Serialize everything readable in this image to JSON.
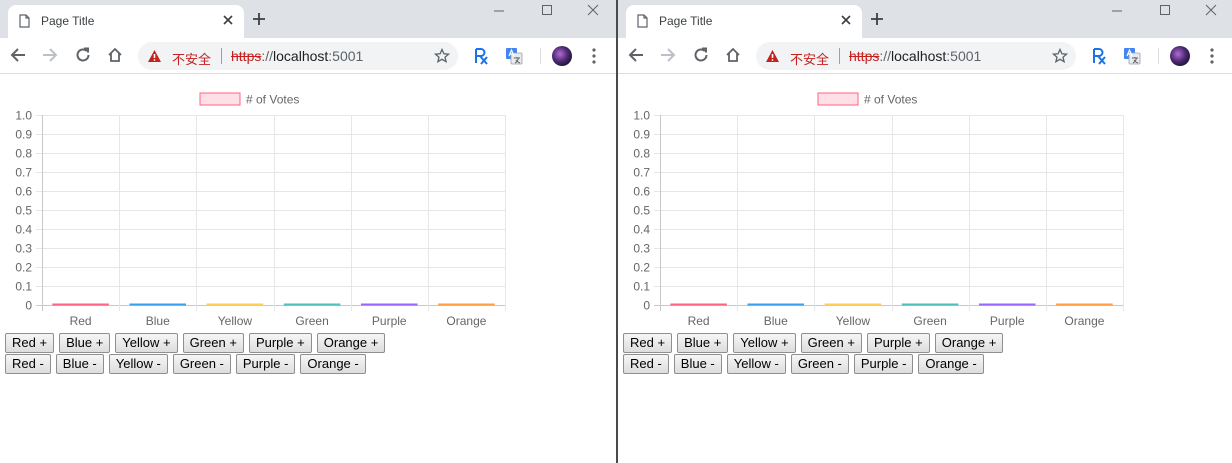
{
  "tab": {
    "title": "Page Title"
  },
  "omnibox": {
    "insecure_label": "不安全",
    "url_scheme": "https",
    "url_sep": "://",
    "url_host": "localhost",
    "url_port": ":5001"
  },
  "chart_data": {
    "type": "bar",
    "categories": [
      "Red",
      "Blue",
      "Yellow",
      "Green",
      "Purple",
      "Orange"
    ],
    "series": [
      {
        "name": "# of Votes",
        "values": [
          0,
          0,
          0,
          0,
          0,
          0
        ]
      }
    ],
    "bar_colors": [
      "#ff6384",
      "#36a2eb",
      "#ffce56",
      "#4bc0c0",
      "#9966ff",
      "#ff9f40"
    ],
    "legend_swatch_fill": "#ffe0e6",
    "legend_swatch_stroke": "#ff6384",
    "ylim": [
      0,
      1.0
    ],
    "yticks": [
      "0",
      "0.1",
      "0.2",
      "0.3",
      "0.4",
      "0.5",
      "0.6",
      "0.7",
      "0.8",
      "0.9",
      "1.0"
    ],
    "legend_position": "top",
    "grid": true
  },
  "buttons": {
    "plus": [
      "Red +",
      "Blue +",
      "Yellow +",
      "Green +",
      "Purple +",
      "Orange +"
    ],
    "minus": [
      "Red -",
      "Blue -",
      "Yellow -",
      "Green -",
      "Purple -",
      "Orange -"
    ]
  }
}
